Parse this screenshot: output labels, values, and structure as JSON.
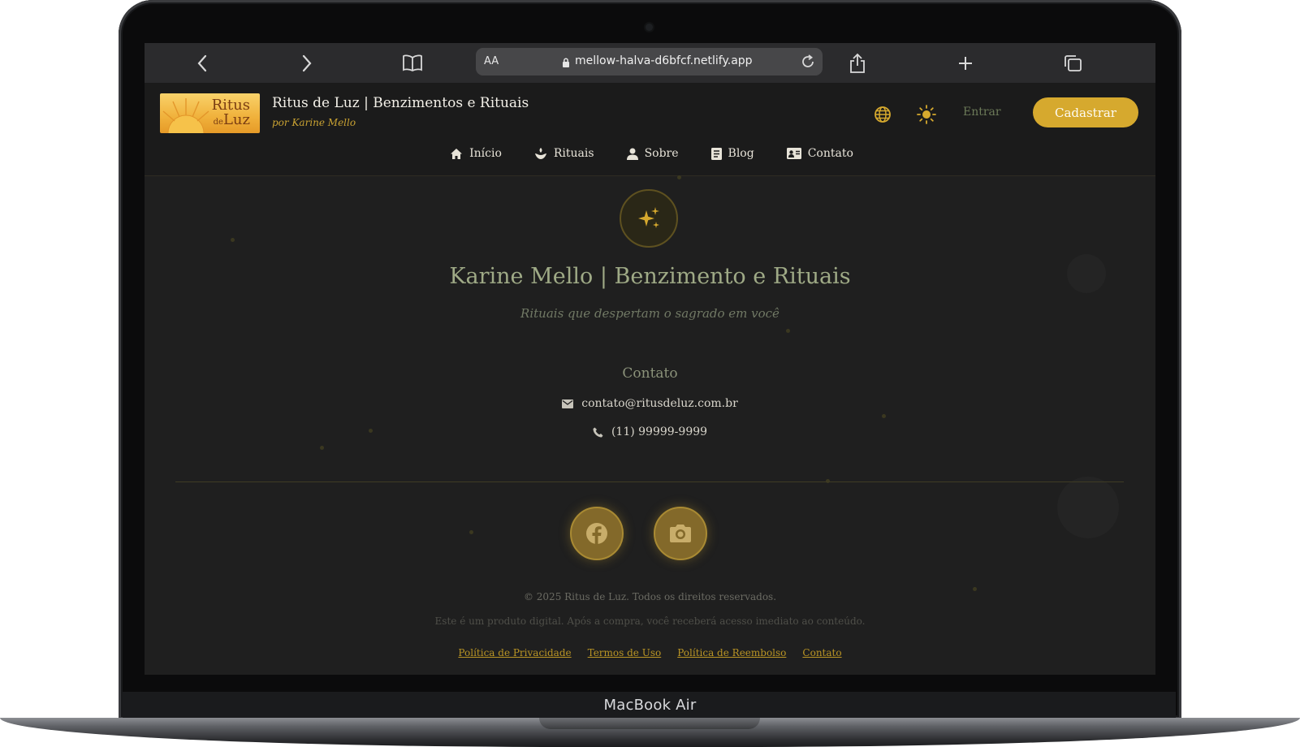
{
  "browser": {
    "text_size_label": "AA",
    "url": "mellow-halva-d6bfcf.netlify.app"
  },
  "header": {
    "logo_text_1": "Ritus",
    "logo_text_de": "de",
    "logo_text_2": "Luz",
    "title": "Ritus de Luz | Benzimentos e Rituais",
    "subtitle": "por Karine Mello",
    "login_label": "Entrar",
    "signup_label": "Cadastrar"
  },
  "nav": [
    {
      "label": "Início",
      "icon": "home-icon"
    },
    {
      "label": "Rituais",
      "icon": "hand-leaf-icon"
    },
    {
      "label": "Sobre",
      "icon": "person-icon"
    },
    {
      "label": "Blog",
      "icon": "document-icon"
    },
    {
      "label": "Contato",
      "icon": "contact-card-icon"
    }
  ],
  "hero": {
    "icon": "sparkles-icon",
    "title": "Karine Mello | Benzimento e Rituais",
    "subtitle": "Rituais que despertam o sagrado em você"
  },
  "contact": {
    "heading": "Contato",
    "email": "contato@ritusdeluz.com.br",
    "phone": "(11) 99999-9999"
  },
  "social": [
    "facebook-icon",
    "camera-icon"
  ],
  "footer": {
    "copyright": "© 2025 Ritus de Luz. Todos os direitos reservados.",
    "note": "Este é um produto digital. Após a compra, você receberá acesso imediato ao conteúdo.",
    "links": [
      "Política de Privacidade",
      "Termos de Uso",
      "Política de Reembolso",
      "Contato"
    ]
  },
  "device_label": "MacBook Air",
  "colors": {
    "accent_gold": "#d6a92e",
    "background": "#1f1f1f",
    "hero_title": "#9faa86"
  }
}
